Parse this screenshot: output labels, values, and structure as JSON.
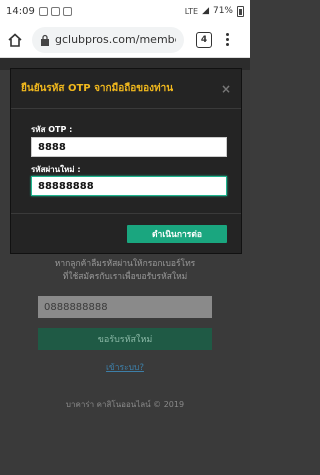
{
  "status_bar": {
    "time": "14:09",
    "signal": "LTE",
    "battery": "71%"
  },
  "browser": {
    "url": "gclubpros.com/membe",
    "tab_count": "4"
  },
  "modal": {
    "title": "ยืนยันรหัส OTP จากมือถือของท่าน",
    "close": "×",
    "otp_label": "รหัส OTP :",
    "otp_value": "8888",
    "new_password_label": "รหัสผ่านใหม่ :",
    "new_password_value": "88888888",
    "continue_button": "ดำเนินการต่อ"
  },
  "page": {
    "instructions_line1": "หากลูกค้าลืมรหัสผ่านให้กรอกเบอร์โทร",
    "instructions_line2": "ที่ใช้สมัครกับเราเพื่อขอรับรหัสใหม่",
    "phone_value": "0888888888",
    "request_button": "ขอรับรหัสใหม่",
    "login_link": "เข้าระบบ?",
    "footer": "บาคาร่า คาสิโนออนไลน์ © 2019"
  },
  "colors": {
    "accent_green": "#1aa67f",
    "title_gold": "#f1b81d"
  }
}
